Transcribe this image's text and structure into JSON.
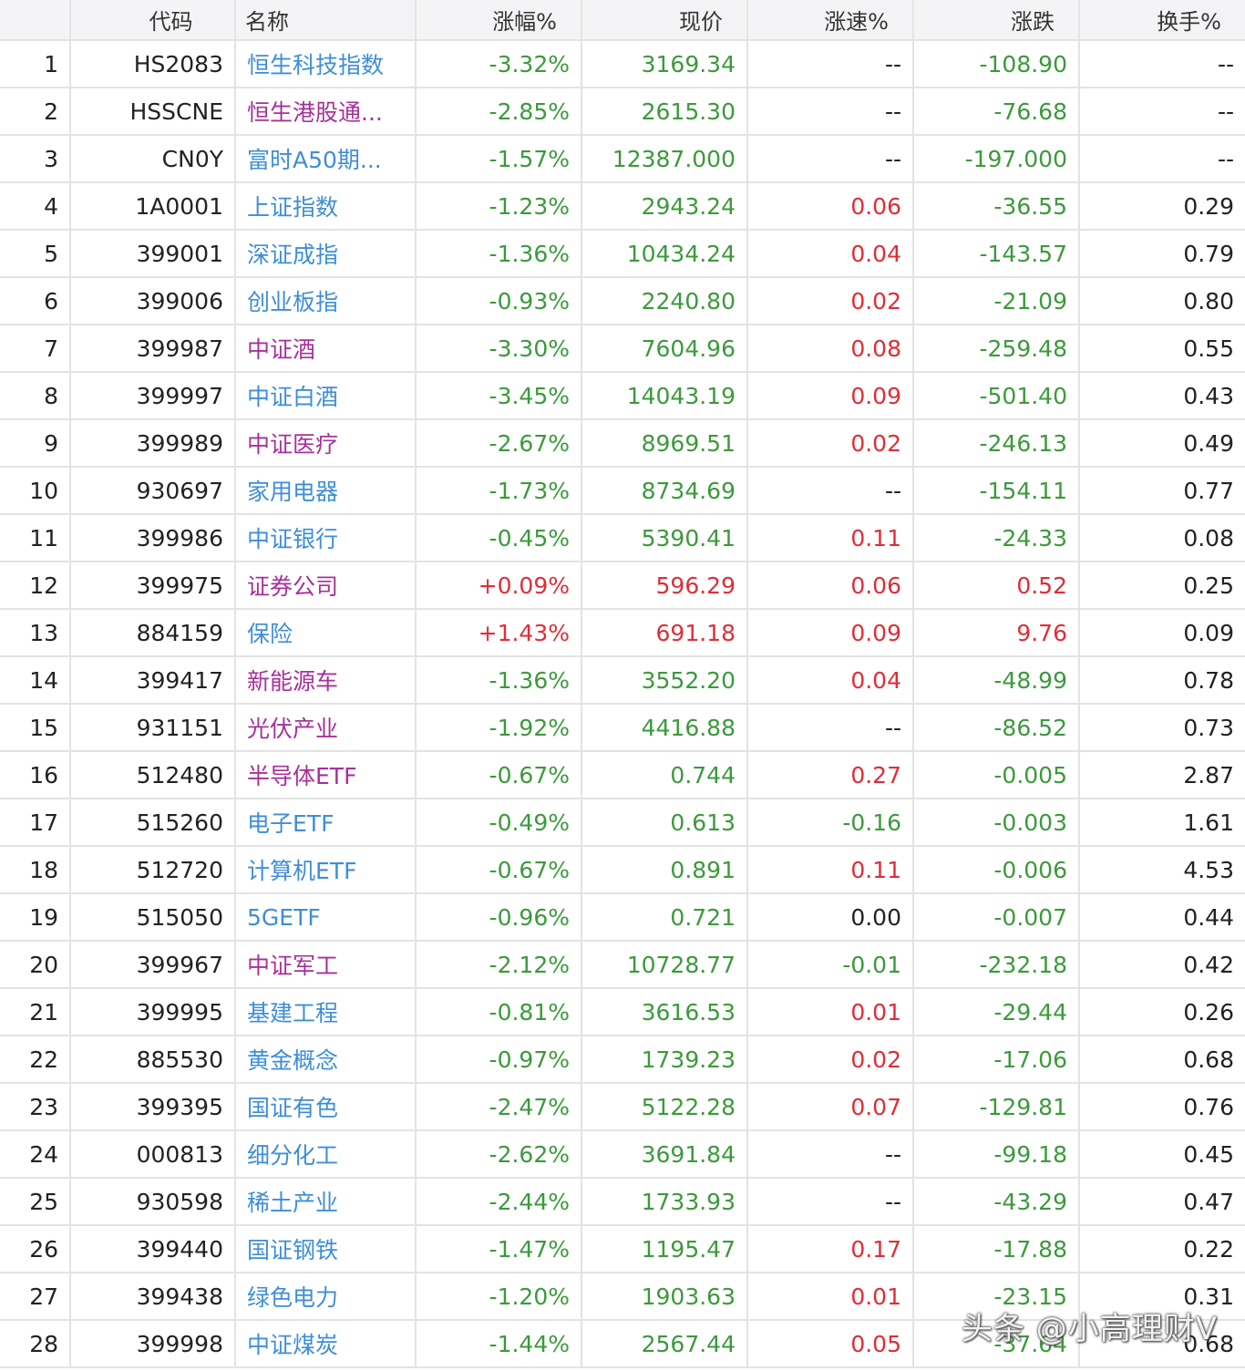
{
  "colors": {
    "up": "#e02d37",
    "down": "#3b9a3b",
    "neutral": "#222222",
    "link_blue": "#3e8ed8",
    "link_purple": "#a8309a",
    "header_bg": "#f4f4f6",
    "grid_line": "#e3e3e3"
  },
  "header": {
    "index": "",
    "code": "代码",
    "name": "名称",
    "pct": "涨幅%",
    "price": "现价",
    "speed": "涨速%",
    "change": "涨跌",
    "turnover": "换手%"
  },
  "rows": [
    {
      "idx": "1",
      "code": "HS2083",
      "name": "恒生科技指数",
      "name_color": "blue",
      "pct": "-3.32%",
      "price": "3169.34",
      "speed": "--",
      "change": "-108.90",
      "turnover": "--",
      "trend": "down",
      "speed_trend": "neutral"
    },
    {
      "idx": "2",
      "code": "HSSCNE",
      "name": "恒生港股通...",
      "name_color": "purple",
      "pct": "-2.85%",
      "price": "2615.30",
      "speed": "--",
      "change": "-76.68",
      "turnover": "--",
      "trend": "down",
      "speed_trend": "neutral"
    },
    {
      "idx": "3",
      "code": "CN0Y",
      "name": "富时A50期...",
      "name_color": "blue",
      "pct": "-1.57%",
      "price": "12387.000",
      "speed": "--",
      "change": "-197.000",
      "turnover": "--",
      "trend": "down",
      "speed_trend": "neutral"
    },
    {
      "idx": "4",
      "code": "1A0001",
      "name": "上证指数",
      "name_color": "blue",
      "pct": "-1.23%",
      "price": "2943.24",
      "speed": "0.06",
      "change": "-36.55",
      "turnover": "0.29",
      "trend": "down",
      "speed_trend": "up"
    },
    {
      "idx": "5",
      "code": "399001",
      "name": "深证成指",
      "name_color": "blue",
      "pct": "-1.36%",
      "price": "10434.24",
      "speed": "0.04",
      "change": "-143.57",
      "turnover": "0.79",
      "trend": "down",
      "speed_trend": "up"
    },
    {
      "idx": "6",
      "code": "399006",
      "name": "创业板指",
      "name_color": "blue",
      "pct": "-0.93%",
      "price": "2240.80",
      "speed": "0.02",
      "change": "-21.09",
      "turnover": "0.80",
      "trend": "down",
      "speed_trend": "up"
    },
    {
      "idx": "7",
      "code": "399987",
      "name": "中证酒",
      "name_color": "purple",
      "pct": "-3.30%",
      "price": "7604.96",
      "speed": "0.08",
      "change": "-259.48",
      "turnover": "0.55",
      "trend": "down",
      "speed_trend": "up"
    },
    {
      "idx": "8",
      "code": "399997",
      "name": "中证白酒",
      "name_color": "blue",
      "pct": "-3.45%",
      "price": "14043.19",
      "speed": "0.09",
      "change": "-501.40",
      "turnover": "0.43",
      "trend": "down",
      "speed_trend": "up"
    },
    {
      "idx": "9",
      "code": "399989",
      "name": "中证医疗",
      "name_color": "purple",
      "pct": "-2.67%",
      "price": "8969.51",
      "speed": "0.02",
      "change": "-246.13",
      "turnover": "0.49",
      "trend": "down",
      "speed_trend": "up"
    },
    {
      "idx": "10",
      "code": "930697",
      "name": "家用电器",
      "name_color": "blue",
      "pct": "-1.73%",
      "price": "8734.69",
      "speed": "--",
      "change": "-154.11",
      "turnover": "0.77",
      "trend": "down",
      "speed_trend": "neutral"
    },
    {
      "idx": "11",
      "code": "399986",
      "name": "中证银行",
      "name_color": "blue",
      "pct": "-0.45%",
      "price": "5390.41",
      "speed": "0.11",
      "change": "-24.33",
      "turnover": "0.08",
      "trend": "down",
      "speed_trend": "up"
    },
    {
      "idx": "12",
      "code": "399975",
      "name": "证券公司",
      "name_color": "purple",
      "pct": "+0.09%",
      "price": "596.29",
      "speed": "0.06",
      "change": "0.52",
      "turnover": "0.25",
      "trend": "up",
      "speed_trend": "up"
    },
    {
      "idx": "13",
      "code": "884159",
      "name": "保险",
      "name_color": "blue",
      "pct": "+1.43%",
      "price": "691.18",
      "speed": "0.09",
      "change": "9.76",
      "turnover": "0.09",
      "trend": "up",
      "speed_trend": "up"
    },
    {
      "idx": "14",
      "code": "399417",
      "name": "新能源车",
      "name_color": "purple",
      "pct": "-1.36%",
      "price": "3552.20",
      "speed": "0.04",
      "change": "-48.99",
      "turnover": "0.78",
      "trend": "down",
      "speed_trend": "up"
    },
    {
      "idx": "15",
      "code": "931151",
      "name": "光伏产业",
      "name_color": "purple",
      "pct": "-1.92%",
      "price": "4416.88",
      "speed": "--",
      "change": "-86.52",
      "turnover": "0.73",
      "trend": "down",
      "speed_trend": "neutral"
    },
    {
      "idx": "16",
      "code": "512480",
      "name": "半导体ETF",
      "name_color": "purple",
      "pct": "-0.67%",
      "price": "0.744",
      "speed": "0.27",
      "change": "-0.005",
      "turnover": "2.87",
      "trend": "down",
      "speed_trend": "up"
    },
    {
      "idx": "17",
      "code": "515260",
      "name": "电子ETF",
      "name_color": "blue",
      "pct": "-0.49%",
      "price": "0.613",
      "speed": "-0.16",
      "change": "-0.003",
      "turnover": "1.61",
      "trend": "down",
      "speed_trend": "down"
    },
    {
      "idx": "18",
      "code": "512720",
      "name": "计算机ETF",
      "name_color": "blue",
      "pct": "-0.67%",
      "price": "0.891",
      "speed": "0.11",
      "change": "-0.006",
      "turnover": "4.53",
      "trend": "down",
      "speed_trend": "up"
    },
    {
      "idx": "19",
      "code": "515050",
      "name": "5GETF",
      "name_color": "blue",
      "pct": "-0.96%",
      "price": "0.721",
      "speed": "0.00",
      "change": "-0.007",
      "turnover": "0.44",
      "trend": "down",
      "speed_trend": "neutral"
    },
    {
      "idx": "20",
      "code": "399967",
      "name": "中证军工",
      "name_color": "purple",
      "pct": "-2.12%",
      "price": "10728.77",
      "speed": "-0.01",
      "change": "-232.18",
      "turnover": "0.42",
      "trend": "down",
      "speed_trend": "down"
    },
    {
      "idx": "21",
      "code": "399995",
      "name": "基建工程",
      "name_color": "blue",
      "pct": "-0.81%",
      "price": "3616.53",
      "speed": "0.01",
      "change": "-29.44",
      "turnover": "0.26",
      "trend": "down",
      "speed_trend": "up"
    },
    {
      "idx": "22",
      "code": "885530",
      "name": "黄金概念",
      "name_color": "blue",
      "pct": "-0.97%",
      "price": "1739.23",
      "speed": "0.02",
      "change": "-17.06",
      "turnover": "0.68",
      "trend": "down",
      "speed_trend": "up"
    },
    {
      "idx": "23",
      "code": "399395",
      "name": "国证有色",
      "name_color": "blue",
      "pct": "-2.47%",
      "price": "5122.28",
      "speed": "0.07",
      "change": "-129.81",
      "turnover": "0.76",
      "trend": "down",
      "speed_trend": "up"
    },
    {
      "idx": "24",
      "code": "000813",
      "name": "细分化工",
      "name_color": "blue",
      "pct": "-2.62%",
      "price": "3691.84",
      "speed": "--",
      "change": "-99.18",
      "turnover": "0.45",
      "trend": "down",
      "speed_trend": "neutral"
    },
    {
      "idx": "25",
      "code": "930598",
      "name": "稀土产业",
      "name_color": "blue",
      "pct": "-2.44%",
      "price": "1733.93",
      "speed": "--",
      "change": "-43.29",
      "turnover": "0.47",
      "trend": "down",
      "speed_trend": "neutral"
    },
    {
      "idx": "26",
      "code": "399440",
      "name": "国证钢铁",
      "name_color": "blue",
      "pct": "-1.47%",
      "price": "1195.47",
      "speed": "0.17",
      "change": "-17.88",
      "turnover": "0.22",
      "trend": "down",
      "speed_trend": "up"
    },
    {
      "idx": "27",
      "code": "399438",
      "name": "绿色电力",
      "name_color": "blue",
      "pct": "-1.20%",
      "price": "1903.63",
      "speed": "0.01",
      "change": "-23.15",
      "turnover": "0.31",
      "trend": "down",
      "speed_trend": "up"
    },
    {
      "idx": "28",
      "code": "399998",
      "name": "中证煤炭",
      "name_color": "blue",
      "pct": "-1.44%",
      "price": "2567.44",
      "speed": "0.05",
      "change": "-37.64",
      "turnover": "0.68",
      "trend": "down",
      "speed_trend": "up"
    }
  ],
  "watermark": "头条 @小高理财V"
}
